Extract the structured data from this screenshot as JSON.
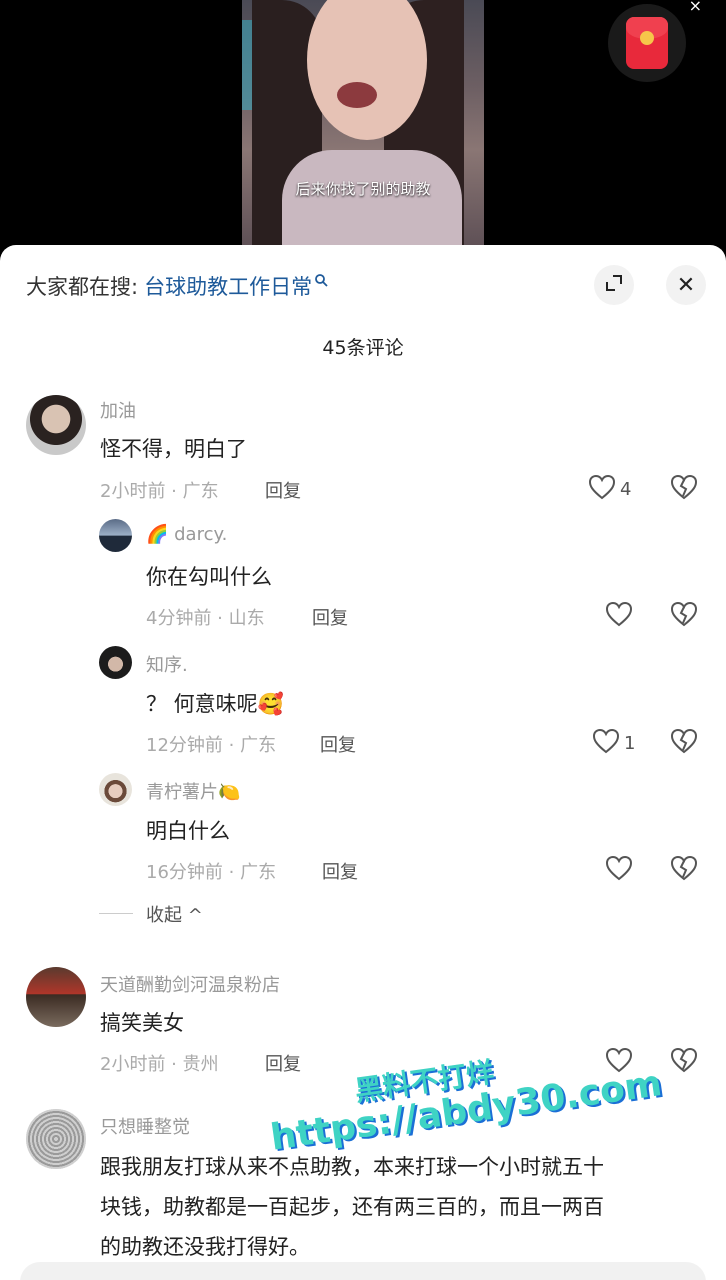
{
  "video": {
    "subtitle": "后来你找了别的助教",
    "close_glyph": "×",
    "red_packet_icon": "red-envelope-icon"
  },
  "header": {
    "search_prefix": "大家都在搜:",
    "search_keyword": "台球助教工作日常",
    "search_icon": "search-icon",
    "expand_icon": "expand-icon",
    "close_glyph": "✕"
  },
  "comments_title": "45条评论",
  "comments": [
    {
      "user": "加油",
      "text": "怪不得，明白了",
      "meta": "2小时前 · 广东",
      "reply": "回复",
      "likes": "4"
    },
    {
      "user": "🌈 darcy.",
      "text": "你在勾叫什么",
      "meta": "4分钟前 · 山东",
      "reply": "回复",
      "likes": ""
    },
    {
      "user": "知序.",
      "text": "？ 何意味呢🥰",
      "meta": "12分钟前 · 广东",
      "reply": "回复",
      "likes": "1"
    },
    {
      "user": "青柠薯片🍋",
      "text": "明白什么",
      "meta": "16分钟前 · 广东",
      "reply": "回复",
      "likes": ""
    },
    {
      "user": "天道酬勤剑河温泉粉店",
      "text": "搞笑美女",
      "meta": "2小时前 · 贵州",
      "reply": "回复",
      "likes": ""
    },
    {
      "user": "只想睡整觉",
      "text_lines": [
        "跟我朋友打球从来不点助教，本来打球一个小时就五十",
        "块钱，助教都是一百起步，还有两三百的，而且一两百",
        "的助教还没我打得好。"
      ]
    }
  ],
  "collapse_label": "收起 ^",
  "watermark": {
    "line1": "黑料不打烊",
    "line2": "https://abdy30.com"
  },
  "colors": {
    "link": "#1e5a9a",
    "accent_watermark": "#3fd3c4"
  }
}
